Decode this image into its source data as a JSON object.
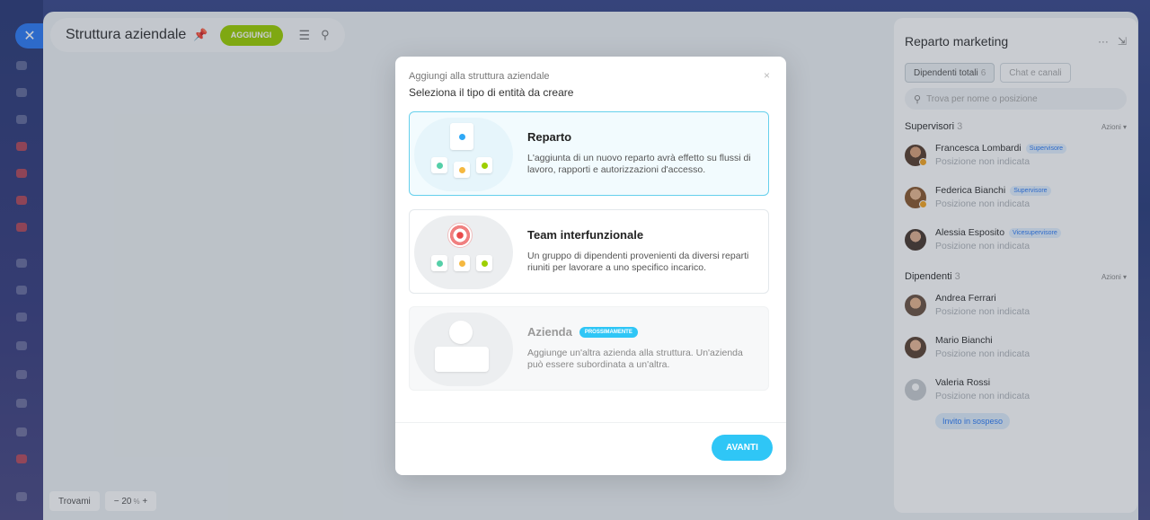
{
  "header": {
    "title": "Struttura aziendale",
    "add_label": "AGGIUNGI",
    "pin_icon": "pin-icon",
    "menu_icon": "menu-icon",
    "search_icon": "search-icon"
  },
  "bottom_tools": {
    "find_label": "Trovami",
    "zoom_minus": "−",
    "zoom_value": "20",
    "zoom_unit": "%",
    "zoom_plus": "+"
  },
  "right_panel": {
    "title": "Reparto marketing",
    "more_icon": "···",
    "collapse_icon": "⇲",
    "tabs": [
      {
        "label": "Dipendenti totali",
        "count": "6"
      },
      {
        "label": "Chat e canali"
      }
    ],
    "search_placeholder": "Trova per nome o posizione",
    "sections": {
      "supervisors": {
        "label": "Supervisori",
        "count": "3",
        "action": "Azioni ▾",
        "members": [
          {
            "name": "Francesca Lombardi",
            "badge": "Supervisore",
            "position": "Posizione non indicata"
          },
          {
            "name": "Federica Bianchi",
            "badge": "Supervisore",
            "position": "Posizione non indicata"
          },
          {
            "name": "Alessia Esposito",
            "badge": "Vicesupervisore",
            "position": "Posizione non indicata"
          }
        ]
      },
      "employees": {
        "label": "Dipendenti",
        "count": "3",
        "action": "Azioni ▾",
        "members": [
          {
            "name": "Andrea Ferrari",
            "position": "Posizione non indicata"
          },
          {
            "name": "Mario Bianchi",
            "position": "Posizione non indicata"
          },
          {
            "name": "Valeria Rossi",
            "position": "Posizione non indicata",
            "status": "Invito in sospeso"
          }
        ]
      }
    }
  },
  "modal": {
    "subtitle": "Aggiungi alla struttura aziendale",
    "title": "Seleziona il tipo di entità da creare",
    "close_icon": "×",
    "options": [
      {
        "title": "Reparto",
        "description": "L'aggiunta di un nuovo reparto avrà effetto su flussi di lavoro, rapporti e autorizzazioni d'accesso."
      },
      {
        "title": "Team interfunzionale",
        "description": "Un gruppo di dipendenti provenienti da diversi reparti riuniti per lavorare a uno specifico incarico."
      },
      {
        "title": "Azienda",
        "badge": "PROSSIMAMENTE",
        "description": "Aggiunge un'altra azienda alla struttura. Un'azienda può essere subordinata a un'altra."
      }
    ],
    "next_label": "AVANTI"
  },
  "colors": {
    "accent": "#2fc6f6",
    "add_button": "#9dcf00",
    "close_button": "#2f7df6"
  }
}
